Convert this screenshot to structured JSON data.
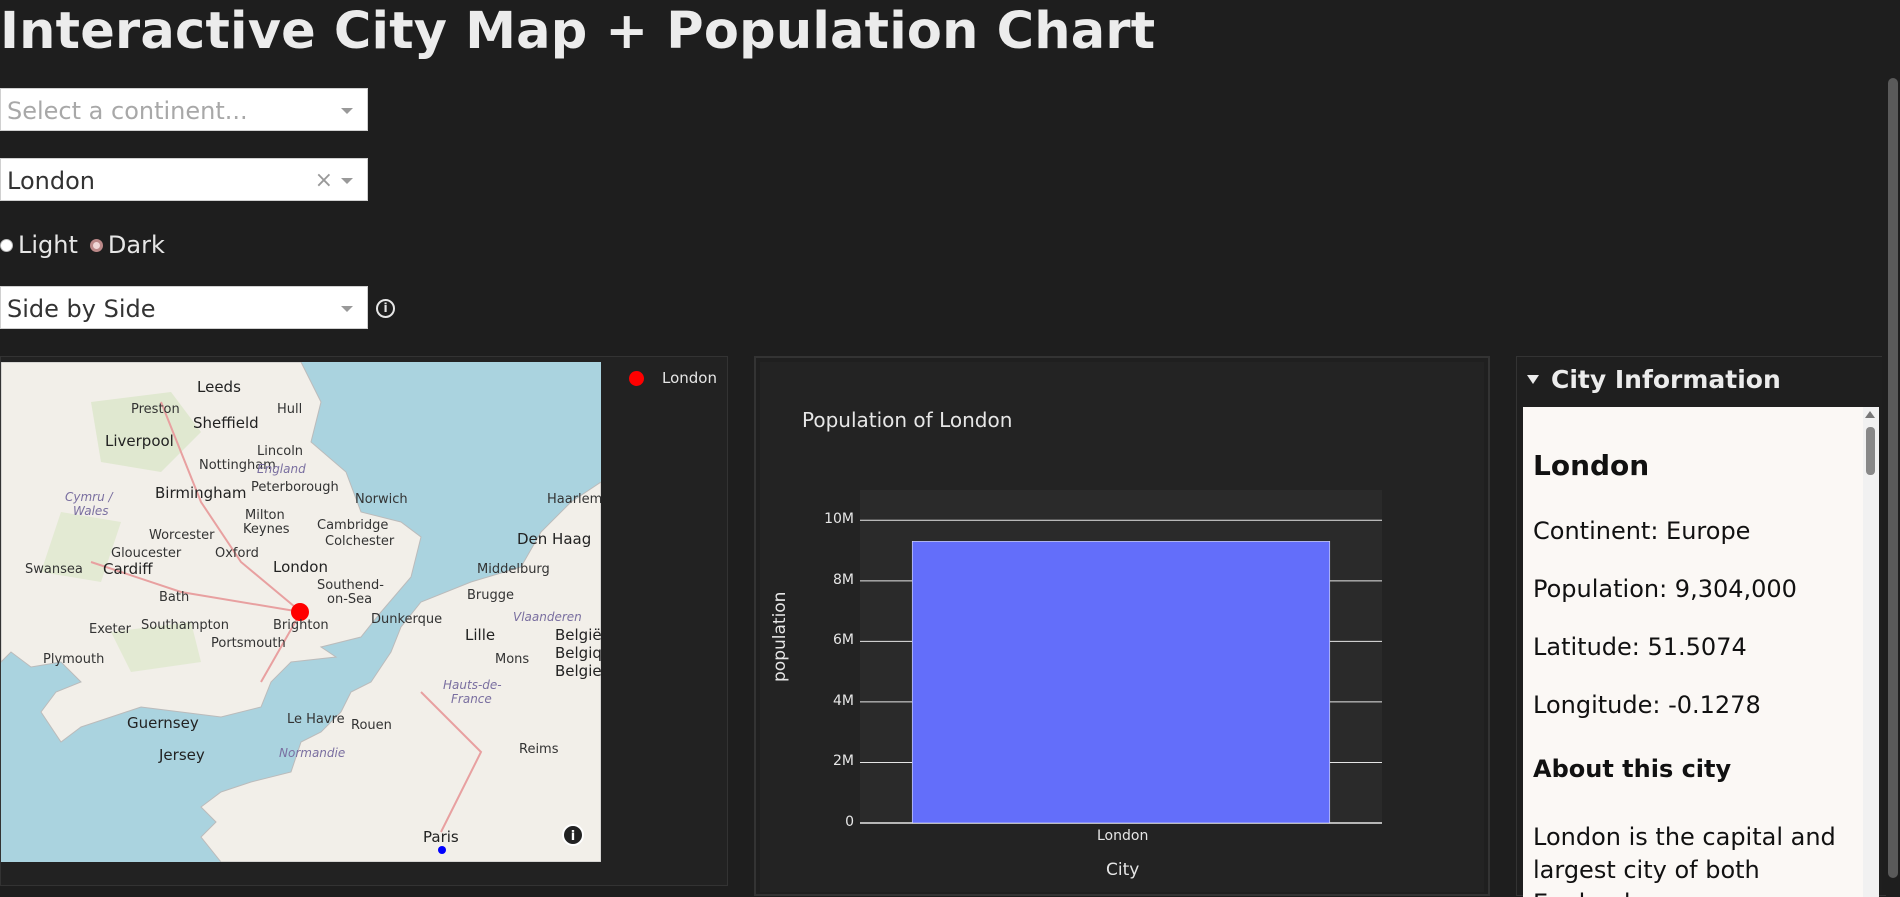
{
  "page": {
    "title": "Interactive City Map + Population Chart"
  },
  "controls": {
    "continent_select": {
      "placeholder": "Select a continent..."
    },
    "city_select": {
      "value": "London",
      "clear": "×"
    },
    "theme": {
      "options": [
        "Light",
        "Dark"
      ],
      "selected": "Dark"
    },
    "layout_select": {
      "value": "Side by Side"
    },
    "info_icon": "ⓘ"
  },
  "map": {
    "legend": "London",
    "labels": {
      "leeds": "Leeds",
      "preston": "Preston",
      "hull": "Hull",
      "sheffield": "Sheffield",
      "liverpool": "Liverpool",
      "lincoln": "Lincoln",
      "nottingham": "Nottingham",
      "england": "England",
      "cymru": "Cymru /",
      "wales": "Wales",
      "birmingham": "Birmingham",
      "peterborough": "Peterborough",
      "norwich": "Norwich",
      "milton": "Milton",
      "keynes": "Keynes",
      "cambridge": "Cambridge",
      "worcester": "Worcester",
      "colchester": "Colchester",
      "haarlem": "Haarlem",
      "denhaag": "Den Haag",
      "gloucester": "Gloucester",
      "oxford": "Oxford",
      "swansea": "Swansea",
      "cardiff": "Cardiff",
      "london": "London",
      "middelburg": "Middelburg",
      "southend": "Southend-",
      "onsea": "on-Sea",
      "bath": "Bath",
      "brugge": "Brugge",
      "dunkerque": "Dunkerque",
      "vlaanderen": "Vlaanderen",
      "exeter": "Exeter",
      "southampton": "Southampton",
      "brighton": "Brighton",
      "lille": "Lille",
      "portsmouth": "Portsmouth",
      "belgie1": "België",
      "belgie2": "Belgiq",
      "belgie3": "Belgie",
      "plymouth": "Plymouth",
      "mons": "Mons",
      "hautsde": "Hauts-de-",
      "france": "France",
      "guernsey": "Guernsey",
      "lehavre": "Le Havre",
      "rouen": "Rouen",
      "jersey": "Jersey",
      "normandie": "Normandie",
      "reims": "Reims",
      "paris": "Paris"
    },
    "info": "i"
  },
  "chart_data": {
    "type": "bar",
    "title": "Population of London",
    "categories": [
      "London"
    ],
    "values": [
      9304000
    ],
    "xlabel": "City",
    "ylabel": "population",
    "ylim": [
      0,
      11000000
    ],
    "yticks": [
      "0",
      "2M",
      "4M",
      "6M",
      "8M",
      "10M"
    ],
    "ytick_values": [
      0,
      2000000,
      4000000,
      6000000,
      8000000,
      10000000
    ],
    "grid": true,
    "colors": {
      "bar": "#636efa",
      "plot_bg": "#2a2a2a",
      "grid": "#e6e6e6"
    }
  },
  "city_info": {
    "header": "City Information",
    "name": "London",
    "continent": "Continent: Europe",
    "population": "Population: 9,304,000",
    "latitude": "Latitude: 51.5074",
    "longitude": "Longitude: -0.1278",
    "about_heading": "About this city",
    "description": "London is the capital and largest city of both England"
  }
}
